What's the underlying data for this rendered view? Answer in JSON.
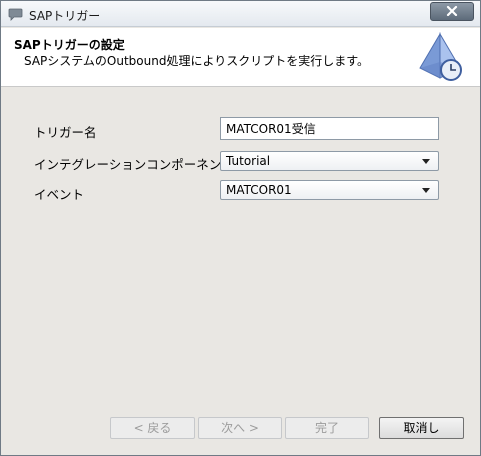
{
  "window": {
    "title": "SAPトリガー",
    "close_glyph": "✕"
  },
  "header": {
    "title": "SAPトリガーの設定",
    "subtitle": "SAPシステムのOutbound処理によりスクリプトを実行します。"
  },
  "form": {
    "trigger_name": {
      "label": "トリガー名",
      "value": "MATCOR01受信"
    },
    "integration_component": {
      "label": "インテグレーションコンポーネント",
      "value": "Tutorial"
    },
    "event": {
      "label": "イベント",
      "value": "MATCOR01"
    }
  },
  "buttons": {
    "back": "< 戻る",
    "next": "次へ >",
    "finish": "完了",
    "cancel": "取消し"
  },
  "colors": {
    "dialog_background": "#e9e7e3",
    "header_background": "#ffffff",
    "disabled_text": "#9c9c9c"
  }
}
